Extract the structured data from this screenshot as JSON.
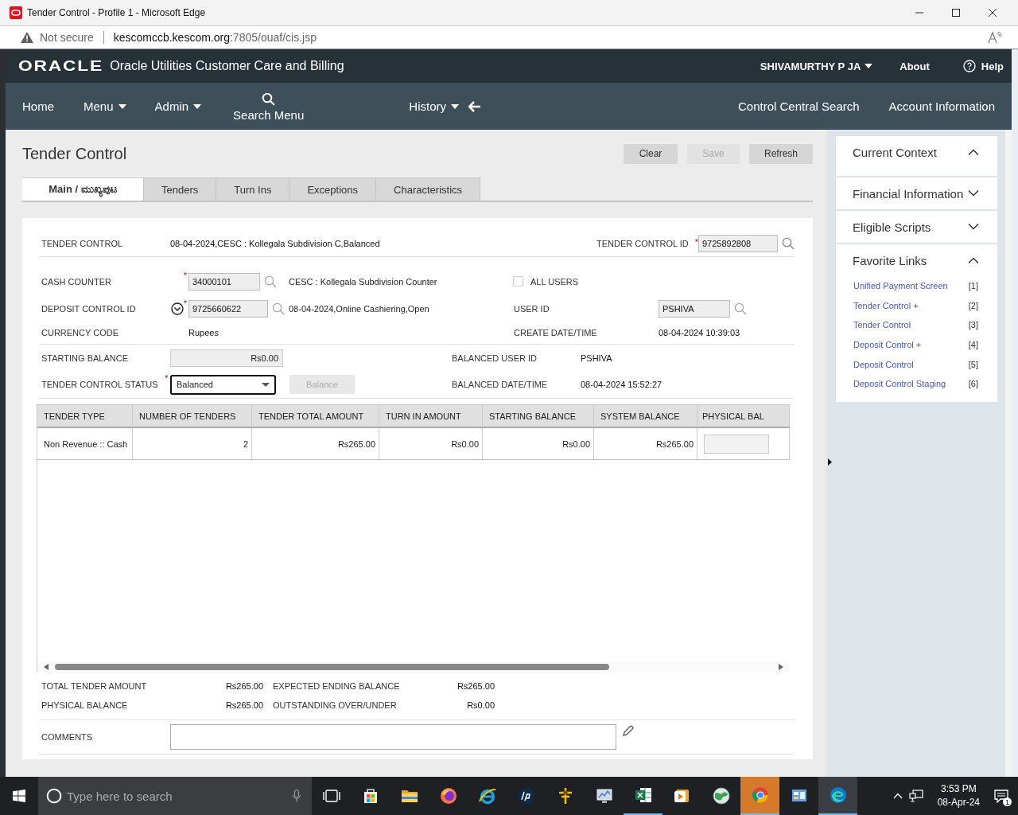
{
  "window": {
    "title": "Tender Control - Profile 1 - Microsoft Edge"
  },
  "address_bar": {
    "security": "Not secure",
    "url_host": "kescomccb.kescom.org",
    "url_path": ":7805/ouaf/cis.jsp"
  },
  "app_header": {
    "logo": "ORACLE",
    "product": "Oracle Utilities Customer Care and Billing",
    "user": "SHIVAMURTHY P JA",
    "about": "About",
    "help": "Help"
  },
  "nav": {
    "left": [
      {
        "label": "Home",
        "dropdown": false
      },
      {
        "label": "Menu",
        "dropdown": true
      },
      {
        "label": "Admin",
        "dropdown": true
      }
    ],
    "search": "Search Menu",
    "history": "History",
    "right": [
      "Control Central Search",
      "Account Information"
    ]
  },
  "page": {
    "title": "Tender Control",
    "actions": [
      {
        "label": "Clear",
        "disabled": false
      },
      {
        "label": "Save",
        "disabled": true
      },
      {
        "label": "Refresh",
        "disabled": false
      }
    ],
    "tabs": [
      {
        "label": "Main / ಮುಖ್ಯಪುಟ",
        "selected": true
      },
      {
        "label": "Tenders",
        "selected": false
      },
      {
        "label": "Turn Ins",
        "selected": false
      },
      {
        "label": "Exceptions",
        "selected": false
      },
      {
        "label": "Characteristics",
        "selected": false
      }
    ],
    "form": {
      "tender_control": {
        "label": "TENDER CONTROL",
        "value": "08-04-2024,CESC : Kollegala Subdivision C,Balanced"
      },
      "tender_control_id": {
        "label": "TENDER CONTROL ID",
        "required_mark": "*",
        "value": "9725892808"
      },
      "cash_counter": {
        "label": "CASH COUNTER",
        "required_mark": "*",
        "value": "34000101",
        "description": "CESC : Kollegala Subdivision Counter"
      },
      "all_users": {
        "label": "ALL USERS",
        "checked": false
      },
      "deposit_control_id": {
        "label": "DEPOSIT CONTROL ID",
        "required_mark": "*",
        "value": "9725660622",
        "description": "08-04-2024,Online Cashiering,Open"
      },
      "user_id": {
        "label": "USER ID",
        "value": "PSHIVA"
      },
      "currency_code": {
        "label": "CURRENCY CODE",
        "value": "Rupees"
      },
      "create_datetime": {
        "label": "CREATE DATE/TIME",
        "value": "08-04-2024 10:39:03"
      },
      "starting_balance": {
        "label": "STARTING BALANCE",
        "value": "Rs0.00"
      },
      "balanced_user_id": {
        "label": "BALANCED USER ID",
        "value": "PSHIVA"
      },
      "status": {
        "label": "TENDER CONTROL STATUS",
        "required_mark": "*",
        "value": "Balanced"
      },
      "balance_button": {
        "label": "Balance",
        "disabled": true
      },
      "balanced_datetime": {
        "label": "BALANCED DATE/TIME",
        "value": "08-04-2024 15:52:27"
      }
    },
    "table": {
      "columns": [
        "TENDER TYPE",
        "NUMBER OF TENDERS",
        "TENDER TOTAL AMOUNT",
        "TURN IN AMOUNT",
        "STARTING BALANCE",
        "SYSTEM BALANCE",
        "PHYSICAL BAL"
      ],
      "rows": [
        {
          "cells": [
            "Non Revenue :: Cash",
            "2",
            "Rs265.00",
            "Rs0.00",
            "Rs0.00",
            "Rs265.00"
          ]
        }
      ]
    },
    "totals": [
      {
        "label": "TOTAL TENDER AMOUNT",
        "value": "Rs265.00"
      },
      {
        "label": "EXPECTED ENDING BALANCE",
        "value": "Rs265.00"
      },
      {
        "label": "PHYSICAL BALANCE",
        "value": "Rs265.00"
      },
      {
        "label": "OUTSTANDING OVER/UNDER",
        "value": "Rs0.00"
      }
    ],
    "comments": {
      "label": "COMMENTS"
    }
  },
  "side_panel": {
    "sections": [
      {
        "title": "Current Context",
        "expanded": true
      },
      {
        "title": "Financial Information",
        "expanded": false
      },
      {
        "title": "Eligible Scripts",
        "expanded": false
      },
      {
        "title": "Favorite Links",
        "expanded": true,
        "links": [
          {
            "label": "Unified Payment Screen",
            "key": "[1]"
          },
          {
            "label": "Tender Control +",
            "key": "[2]"
          },
          {
            "label": "Tender Control",
            "key": "[3]"
          },
          {
            "label": "Deposit Control +",
            "key": "[4]"
          },
          {
            "label": "Deposit Control",
            "key": "[5]"
          },
          {
            "label": "Deposit Control Staging",
            "key": "[6]"
          }
        ]
      }
    ]
  },
  "taskbar": {
    "search_placeholder": "Type here to search",
    "apps": [
      {
        "kind": "taskview",
        "open": false,
        "active": false,
        "flashing": false
      },
      {
        "kind": "store",
        "open": false,
        "active": false,
        "flashing": false
      },
      {
        "kind": "folder",
        "open": false,
        "active": false,
        "flashing": false
      },
      {
        "kind": "firefox",
        "open": false,
        "active": false,
        "flashing": false
      },
      {
        "kind": "ie",
        "open": false,
        "active": false,
        "flashing": false
      },
      {
        "kind": "hp",
        "open": false,
        "active": false,
        "flashing": false
      },
      {
        "kind": "antenna",
        "open": false,
        "active": false,
        "flashing": false
      },
      {
        "kind": "monitor",
        "open": false,
        "active": false,
        "flashing": false
      },
      {
        "kind": "excel",
        "open": true,
        "active": false,
        "flashing": false
      },
      {
        "kind": "player",
        "open": false,
        "active": false,
        "flashing": false
      },
      {
        "kind": "globe",
        "open": false,
        "active": false,
        "flashing": false
      },
      {
        "kind": "chrome",
        "open": true,
        "active": false,
        "flashing": true
      },
      {
        "kind": "panel",
        "open": false,
        "active": false,
        "flashing": false
      },
      {
        "kind": "edge",
        "open": true,
        "active": true,
        "flashing": false
      }
    ],
    "time": "3:53 PM",
    "date": "08-Apr-24",
    "notifications": "1"
  }
}
